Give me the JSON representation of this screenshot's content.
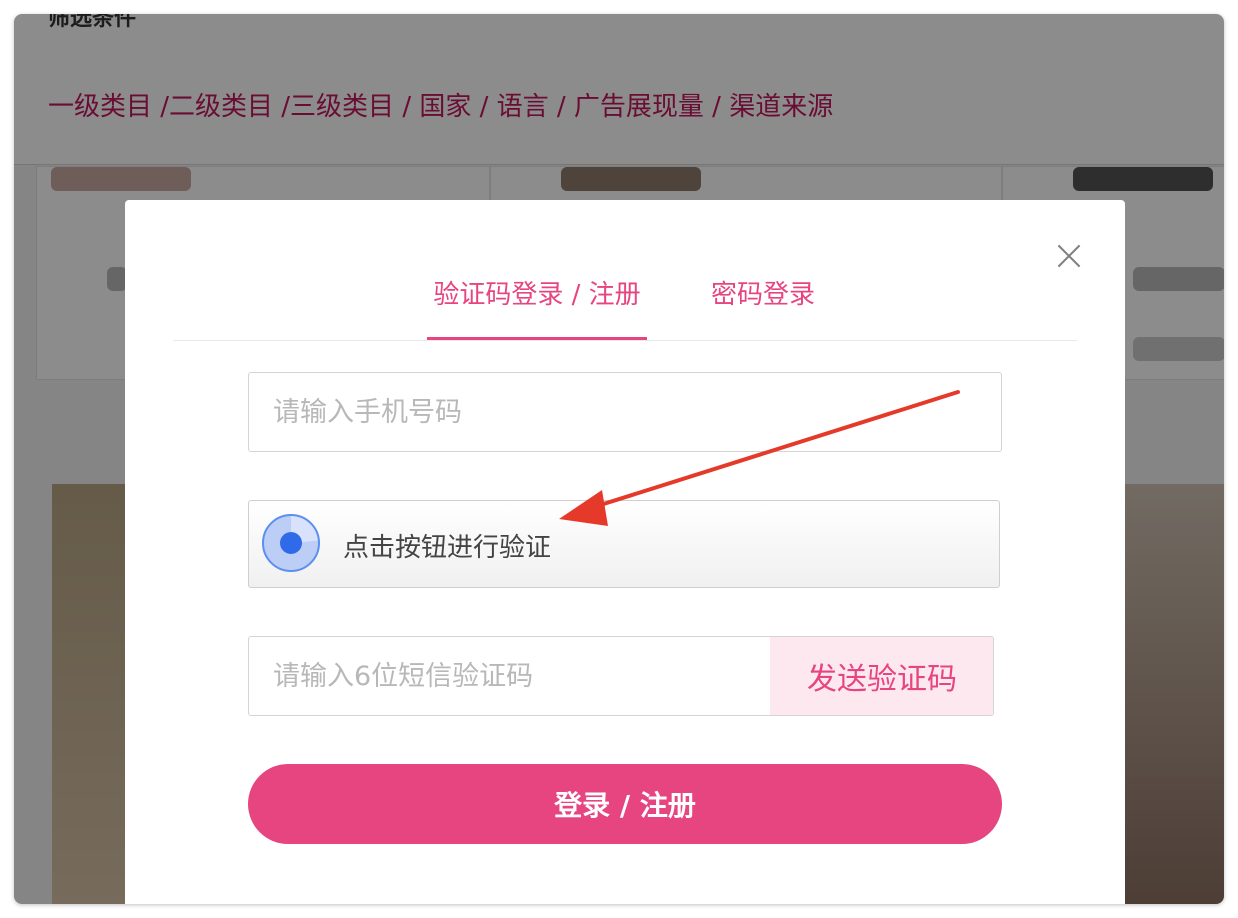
{
  "background": {
    "cut_title": "筛选条件",
    "filters": "一级类目 /二级类目 /三级类目 / 国家 / 语言 / 广告展现量 / 渠道来源"
  },
  "login_modal": {
    "tabs": [
      {
        "label": "验证码登录 / 注册",
        "active": true
      },
      {
        "label": "密码登录",
        "active": false
      }
    ],
    "phone_placeholder": "请输入手机号码",
    "verify_label": "点击按钮进行验证",
    "sms_placeholder": "请输入6位短信验证码",
    "send_code_label": "发送验证码",
    "submit_label": "登录 / 注册"
  },
  "icons": {
    "close": "close-icon",
    "verify": "captcha-verify-icon",
    "annotation": "red-arrow-annotation"
  },
  "colors": {
    "accent": "#e6457f",
    "accent_light": "#fde8f0",
    "verify_blue": "#2f6be8",
    "annotation_red": "#e53a2a"
  }
}
